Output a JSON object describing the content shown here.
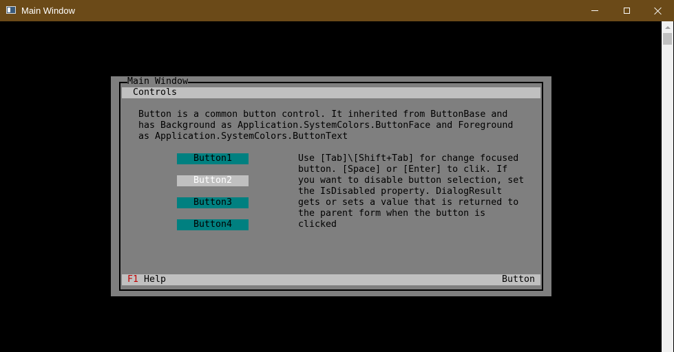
{
  "window": {
    "title": "Main Window"
  },
  "dialog": {
    "frame_title": "Main Window",
    "menu_label": "Controls",
    "description": "Button is a common button control. It inherited from ButtonBase and\nhas Background as Application.SystemColors.ButtonFace and Foreground\nas Application.SystemColors.ButtonText",
    "buttons": [
      {
        "label": "Button1",
        "enabled": true
      },
      {
        "label": "Button2",
        "enabled": false
      },
      {
        "label": "Button3",
        "enabled": true
      },
      {
        "label": "Button4",
        "enabled": true
      }
    ],
    "help_text": "Use [Tab]\\[Shift+Tab] for change focused\nbutton. [Space] or [Enter] to clik. If\nyou want to disable button selection, set\nthe IsDisabled property. DialogResult\ngets or sets a value that is returned to\nthe parent form when the button is\nclicked"
  },
  "status_bar": {
    "key": "F1",
    "key_label": "Help",
    "right_text": "Button"
  },
  "colors": {
    "titlebar": "#6b4a18",
    "dialog_bg": "#7f7f7f",
    "button_enabled": "#008080",
    "button_disabled": "#c0c0c0",
    "hotkey": "#c00000"
  },
  "icons": {
    "app": "app-window-icon",
    "minimize": "minimize-icon",
    "maximize": "maximize-icon",
    "close": "close-icon",
    "scroll_up": "scroll-up-arrow-icon"
  }
}
